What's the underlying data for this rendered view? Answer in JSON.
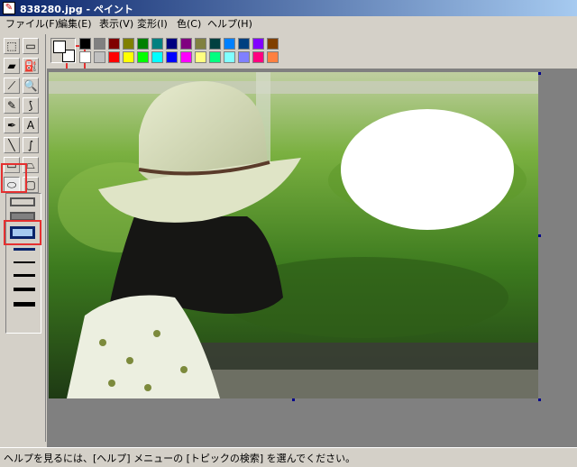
{
  "window": {
    "title": "838280.jpg - ペイント"
  },
  "menu": [
    "ファイル(F)",
    "編集(E)",
    "表示(V)",
    "変形(I)",
    "色(C)",
    "ヘルプ(H)"
  ],
  "toolbox": {
    "tools": [
      {
        "name": "free-select-icon",
        "glyph": "⬚"
      },
      {
        "name": "rect-select-icon",
        "glyph": "▭"
      },
      {
        "name": "eraser-icon",
        "glyph": "▰"
      },
      {
        "name": "fill-bucket-icon",
        "glyph": "⛽"
      },
      {
        "name": "color-picker-icon",
        "glyph": "⟋"
      },
      {
        "name": "magnifier-icon",
        "glyph": "🔍"
      },
      {
        "name": "pencil-icon",
        "glyph": "✎"
      },
      {
        "name": "brush-icon",
        "glyph": "⟆"
      },
      {
        "name": "airbrush-icon",
        "glyph": "✒"
      },
      {
        "name": "text-icon",
        "glyph": "A"
      },
      {
        "name": "line-icon",
        "glyph": "╲"
      },
      {
        "name": "curve-icon",
        "glyph": "∫"
      },
      {
        "name": "rectangle-icon",
        "glyph": "▭"
      },
      {
        "name": "polygon-icon",
        "glyph": "⏢"
      },
      {
        "name": "ellipse-icon",
        "glyph": "⬭"
      },
      {
        "name": "rounded-rect-icon",
        "glyph": "▢"
      }
    ],
    "selected_tool": "ellipse-icon"
  },
  "palette": {
    "foreground": "#ffffff",
    "background": "#ffffff",
    "row1": [
      "#000000",
      "#808080",
      "#800000",
      "#808000",
      "#008000",
      "#008080",
      "#000080",
      "#800080",
      "#808040",
      "#004040",
      "#0080ff",
      "#004080",
      "#8000ff",
      "#804000"
    ],
    "row2": [
      "#ffffff",
      "#c0c0c0",
      "#ff0000",
      "#ffff00",
      "#00ff00",
      "#00ffff",
      "#0000ff",
      "#ff00ff",
      "#ffff80",
      "#00ff80",
      "#80ffff",
      "#8080ff",
      "#ff0080",
      "#ff8040"
    ]
  },
  "status": {
    "text": "ヘルプを見るには、[ヘルプ] メニューの [トピックの検索] を選んでください。"
  },
  "colors": {
    "titlebar": "#0a246a",
    "face": "#d4d0c8",
    "workspace": "#808080",
    "highlight": "#e53030"
  }
}
